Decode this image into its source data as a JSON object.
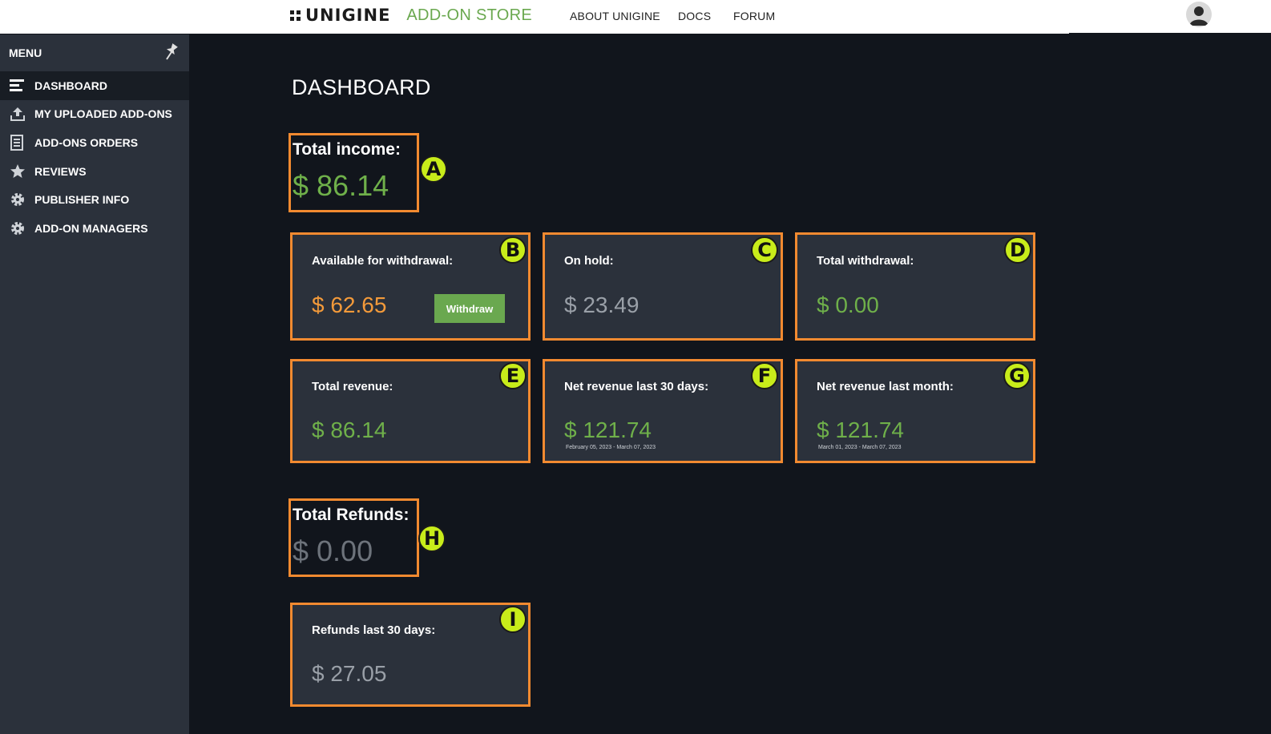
{
  "header": {
    "logo_text": "UNIGINE",
    "store_text": "ADD-ON STORE",
    "nav": [
      "ABOUT UNIGINE",
      "DOCS",
      "FORUM"
    ],
    "avatar_icon": "user-icon"
  },
  "sidebar": {
    "title": "MENU",
    "pin_icon": "pin-icon",
    "items": [
      {
        "label": "DASHBOARD",
        "icon": "dashboard-icon",
        "active": true
      },
      {
        "label": "MY UPLOADED ADD-ONS",
        "icon": "upload-icon",
        "active": false
      },
      {
        "label": "ADD-ONS ORDERS",
        "icon": "orders-icon",
        "active": false
      },
      {
        "label": "REVIEWS",
        "icon": "star-icon",
        "active": false
      },
      {
        "label": "PUBLISHER INFO",
        "icon": "gear-icon",
        "active": false
      },
      {
        "label": "ADD-ON MANAGERS",
        "icon": "gear-icon",
        "active": false
      }
    ]
  },
  "main": {
    "title": "DASHBOARD",
    "total_income": {
      "label": "Total income:",
      "value": "$ 86.14",
      "marker": "A"
    },
    "available": {
      "label": "Available for withdrawal:",
      "value": "$ 62.65",
      "button": "Withdraw",
      "marker": "B"
    },
    "on_hold": {
      "label": "On hold:",
      "value": "$ 23.49",
      "marker": "C"
    },
    "total_withdrawal": {
      "label": "Total withdrawal:",
      "value": "$ 0.00",
      "marker": "D"
    },
    "total_revenue": {
      "label": "Total revenue:",
      "value": "$ 86.14",
      "marker": "E"
    },
    "net_30": {
      "label": "Net revenue last 30 days:",
      "value": "$ 121.74",
      "range": "February 05, 2023 - March 07, 2023",
      "marker": "F"
    },
    "net_month": {
      "label": "Net revenue last month:",
      "value": "$ 121.74",
      "range": "March 01, 2023 - March 07, 2023",
      "marker": "G"
    },
    "total_refunds": {
      "label": "Total Refunds:",
      "value": "$ 0.00",
      "marker": "H"
    },
    "refunds_30": {
      "label": "Refunds last 30 days:",
      "value": "$ 27.05",
      "marker": "I"
    }
  },
  "colors": {
    "accent_green": "#6aa84f",
    "highlight_orange": "#f28a30",
    "marker_yellow": "#c8ec1a",
    "sidebar_bg": "#2b313b",
    "page_bg": "#11151c"
  }
}
